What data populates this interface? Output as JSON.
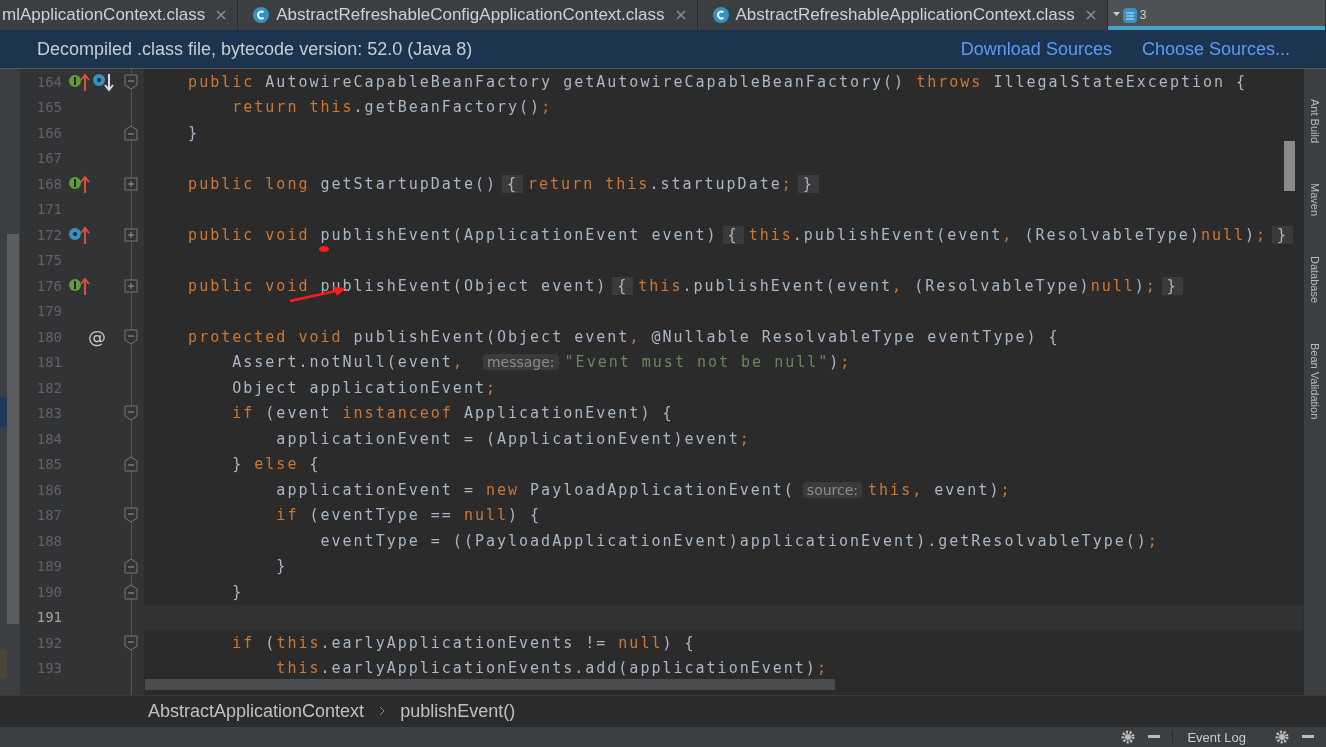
{
  "tabs": [
    {
      "label": "mlApplicationContext.class",
      "icon": false,
      "selected": false
    },
    {
      "label": "AbstractRefreshableConfigApplicationContext.class",
      "icon": true,
      "selected": false
    },
    {
      "label": "AbstractRefreshableApplicationContext.class",
      "icon": true,
      "selected": false
    }
  ],
  "tab_overflow": {
    "count": "3",
    "selected": true
  },
  "banner": {
    "text": "Decompiled .class file, bytecode version: 52.0 (Java 8)",
    "links": [
      "Download Sources",
      "Choose Sources..."
    ]
  },
  "editor": {
    "lines": [
      {
        "n": "164",
        "fold_marker": {
          "kind": "start"
        },
        "current": false,
        "marks": [
          {
            "kind": "implemented-up"
          },
          {
            "kind": "override-down"
          }
        ],
        "tokens": [
          {
            "kind": "kw",
            "text": "    public "
          },
          {
            "kind": "plain",
            "text": "AutowireCapableBeanFactory getAutowireCapableBeanFactory() "
          },
          {
            "kind": "kw",
            "text": "throws "
          },
          {
            "kind": "plain",
            "text": "IllegalStateException {"
          }
        ]
      },
      {
        "n": "165",
        "current": false,
        "tokens": [
          {
            "kind": "kw",
            "text": "        return this"
          },
          {
            "kind": "plain",
            "text": ".getBeanFactory()"
          },
          {
            "kind": "kw",
            "text": ";"
          }
        ]
      },
      {
        "n": "166",
        "fold_marker": {
          "kind": "end"
        },
        "current": false,
        "tokens": [
          {
            "kind": "plain",
            "text": "    }"
          }
        ]
      },
      {
        "n": "167",
        "current": false
      },
      {
        "n": "168",
        "fold_marker": {
          "kind": "collapsed"
        },
        "current": false,
        "marks": [
          {
            "kind": "implemented-up"
          }
        ],
        "tokens": [
          {
            "kind": "kw",
            "text": "    public long "
          },
          {
            "kind": "plain",
            "text": "getStartupDate()"
          },
          {
            "kind": "fold",
            "text": "{"
          },
          {
            "kind": "kw",
            "text": "return this"
          },
          {
            "kind": "plain",
            "text": ".startupDate"
          },
          {
            "kind": "kw",
            "text": ";"
          },
          {
            "kind": "fold",
            "text": "}"
          }
        ]
      },
      {
        "n": "171",
        "current": false
      },
      {
        "n": "172",
        "fold_marker": {
          "kind": "collapsed"
        },
        "current": false,
        "marks": [
          {
            "kind": "override-up"
          }
        ],
        "tokens": [
          {
            "kind": "kw",
            "text": "    public void "
          },
          {
            "kind": "plain",
            "text": "publishEvent(ApplicationEvent event)"
          },
          {
            "kind": "fold",
            "text": "{"
          },
          {
            "kind": "kw",
            "text": "this"
          },
          {
            "kind": "plain",
            "text": ".publishEvent(event"
          },
          {
            "kind": "kw",
            "text": ", "
          },
          {
            "kind": "plain",
            "text": "(ResolvableType)"
          },
          {
            "kind": "kw",
            "text": "null"
          },
          {
            "kind": "plain",
            "text": ")"
          },
          {
            "kind": "kw",
            "text": ";"
          },
          {
            "kind": "fold",
            "text": "}"
          }
        ]
      },
      {
        "n": "175",
        "current": false
      },
      {
        "n": "176",
        "fold_marker": {
          "kind": "collapsed"
        },
        "current": false,
        "marks": [
          {
            "kind": "implemented-up"
          }
        ],
        "tokens": [
          {
            "kind": "kw",
            "text": "    public void "
          },
          {
            "kind": "plain",
            "text": "publishEvent(Object event)"
          },
          {
            "kind": "fold",
            "text": "{"
          },
          {
            "kind": "kw",
            "text": "this"
          },
          {
            "kind": "plain",
            "text": ".publishEvent(event"
          },
          {
            "kind": "kw",
            "text": ", "
          },
          {
            "kind": "plain",
            "text": "(ResolvableType)"
          },
          {
            "kind": "kw",
            "text": "null"
          },
          {
            "kind": "plain",
            "text": ")"
          },
          {
            "kind": "kw",
            "text": ";"
          },
          {
            "kind": "fold",
            "text": "}"
          }
        ]
      },
      {
        "n": "179",
        "current": false
      },
      {
        "n": "180",
        "fold_marker": {
          "kind": "start"
        },
        "current": false,
        "marks": [
          {
            "kind": "text",
            "text": "@"
          }
        ],
        "tokens": [
          {
            "kind": "kw",
            "text": "    protected void "
          },
          {
            "kind": "plain",
            "text": "publishEvent(Object event"
          },
          {
            "kind": "kw",
            "text": ", "
          },
          {
            "kind": "plain",
            "text": "@Nullable ResolvableType eventType) {"
          }
        ]
      },
      {
        "n": "181",
        "current": false,
        "tokens": [
          {
            "kind": "plain",
            "text": "        Assert.notNull(event"
          },
          {
            "kind": "kw",
            "text": ", "
          },
          {
            "kind": "hint",
            "text": "message:"
          },
          {
            "kind": "str",
            "text": "\"Event must not be null\""
          },
          {
            "kind": "plain",
            "text": ")"
          },
          {
            "kind": "kw",
            "text": ";"
          }
        ]
      },
      {
        "n": "182",
        "current": false,
        "tokens": [
          {
            "kind": "plain",
            "text": "        Object applicationEvent"
          },
          {
            "kind": "kw",
            "text": ";"
          }
        ]
      },
      {
        "n": "183",
        "fold_marker": {
          "kind": "start"
        },
        "current": false,
        "tokens": [
          {
            "kind": "kw",
            "text": "        if "
          },
          {
            "kind": "plain",
            "text": "(event "
          },
          {
            "kind": "kw",
            "text": "instanceof "
          },
          {
            "kind": "plain",
            "text": "ApplicationEvent) {"
          }
        ]
      },
      {
        "n": "184",
        "current": false,
        "tokens": [
          {
            "kind": "plain",
            "text": "            applicationEvent = (ApplicationEvent)event"
          },
          {
            "kind": "kw",
            "text": ";"
          }
        ]
      },
      {
        "n": "185",
        "fold_marker": {
          "kind": "end"
        },
        "current": false,
        "tokens": [
          {
            "kind": "plain",
            "text": "        } "
          },
          {
            "kind": "kw",
            "text": "else "
          },
          {
            "kind": "plain",
            "text": "{"
          }
        ]
      },
      {
        "n": "186",
        "current": false,
        "tokens": [
          {
            "kind": "plain",
            "text": "            applicationEvent = "
          },
          {
            "kind": "kw",
            "text": "new "
          },
          {
            "kind": "plain",
            "text": "PayloadApplicationEvent("
          },
          {
            "kind": "hint",
            "text": "source:"
          },
          {
            "kind": "kw",
            "text": "this, "
          },
          {
            "kind": "plain",
            "text": "event)"
          },
          {
            "kind": "kw",
            "text": ";"
          }
        ]
      },
      {
        "n": "187",
        "fold_marker": {
          "kind": "start"
        },
        "current": false,
        "tokens": [
          {
            "kind": "kw",
            "text": "            if "
          },
          {
            "kind": "plain",
            "text": "(eventType == "
          },
          {
            "kind": "kw",
            "text": "null"
          },
          {
            "kind": "plain",
            "text": ") {"
          }
        ]
      },
      {
        "n": "188",
        "current": false,
        "tokens": [
          {
            "kind": "plain",
            "text": "                eventType = ((PayloadApplicationEvent)applicationEvent).getResolvableType()"
          },
          {
            "kind": "kw",
            "text": ";"
          }
        ]
      },
      {
        "n": "189",
        "fold_marker": {
          "kind": "end"
        },
        "current": false,
        "tokens": [
          {
            "kind": "plain",
            "text": "            }"
          }
        ]
      },
      {
        "n": "190",
        "fold_marker": {
          "kind": "end"
        },
        "current": false,
        "tokens": [
          {
            "kind": "plain",
            "text": "        }"
          }
        ]
      },
      {
        "n": "191",
        "current": true
      },
      {
        "n": "192",
        "fold_marker": {
          "kind": "start"
        },
        "current": false,
        "tokens": [
          {
            "kind": "kw",
            "text": "        if "
          },
          {
            "kind": "plain",
            "text": "("
          },
          {
            "kind": "kw",
            "text": "this"
          },
          {
            "kind": "plain",
            "text": ".earlyApplicationEvents != "
          },
          {
            "kind": "kw",
            "text": "null"
          },
          {
            "kind": "plain",
            "text": ") {"
          }
        ]
      },
      {
        "n": "193",
        "current": false,
        "tokens": [
          {
            "kind": "kw",
            "text": "            this"
          },
          {
            "kind": "plain",
            "text": ".earlyApplicationEvents.add(applicationEvent)"
          },
          {
            "kind": "kw",
            "text": ";"
          }
        ]
      }
    ]
  },
  "breadcrumbs": [
    "AbstractApplicationContext",
    "publishEvent()"
  ],
  "tool_windows": [
    "Ant Build",
    "Maven",
    "Database",
    "Bean Validation"
  ],
  "status_bar": {
    "tab": "Event Log"
  }
}
